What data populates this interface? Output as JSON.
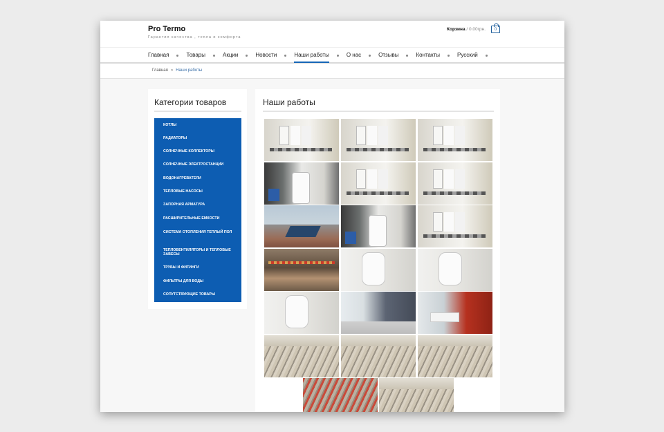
{
  "header": {
    "brand": "Pro Termo",
    "tagline": "Гарантия качества , тепла и комфорта",
    "cart_label": "Корзина",
    "cart_sum": " / 0.00грн.",
    "cart_count": "0"
  },
  "nav": {
    "items": [
      "Главная",
      "Товары",
      "Акции",
      "Новости",
      "Наши работы",
      "О нас",
      "Отзывы",
      "Контакты",
      "Русский"
    ],
    "active": "Наши работы"
  },
  "breadcrumb": {
    "home": "Главная",
    "sep": "»",
    "current": "Наши работы"
  },
  "sidebar": {
    "title": "Категории товаров",
    "categories": [
      "котлы",
      "радиаторы",
      "солнечные коллекторы",
      "солнечные электростанции",
      "водонагреватели",
      "тепловые насосы",
      "запорная арматура",
      "расширительные емкости",
      "система отопления теплый пол",
      "тепловентиляторы и тепловые завесы",
      "трубы и фитинги",
      "фильтры для воды",
      "сопутствующие товары"
    ]
  },
  "main": {
    "title": "Наши работы",
    "photos": [
      "boiler",
      "boiler",
      "boiler",
      "tank",
      "boiler",
      "boiler",
      "roof",
      "tank",
      "boiler",
      "manifold",
      "wallheater",
      "wallheater",
      "wallheater",
      "room",
      "redroom",
      "floor",
      "floor",
      "floor",
      "floorred",
      "floor"
    ]
  },
  "colors": {
    "accent": "#0d5db2",
    "nav_active": "#1565b6"
  }
}
